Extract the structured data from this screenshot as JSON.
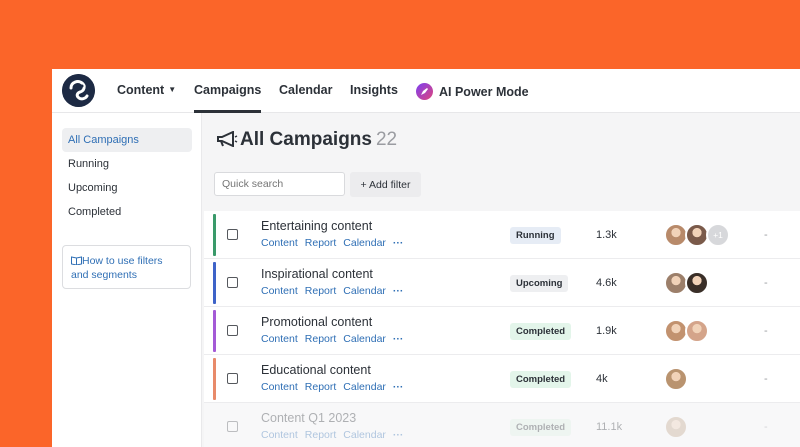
{
  "nav": {
    "items": [
      {
        "label": "Content",
        "has_caret": true
      },
      {
        "label": "Campaigns",
        "active": true
      },
      {
        "label": "Calendar"
      },
      {
        "label": "Insights"
      },
      {
        "label": "AI Power Mode"
      }
    ]
  },
  "sidebar": {
    "items": [
      {
        "label": "All Campaigns",
        "active": true
      },
      {
        "label": "Running"
      },
      {
        "label": "Upcoming"
      },
      {
        "label": "Completed"
      }
    ],
    "help_text": "How to use filters and segments"
  },
  "main": {
    "title": "All Campaigns",
    "count": "22",
    "search_placeholder": "Quick search",
    "add_filter_label": "+ Add filter",
    "row_links": [
      "Content",
      "Report",
      "Calendar",
      "···"
    ],
    "rows": [
      {
        "name": "Entertaining content",
        "status": "Running",
        "count": "1.3k",
        "avatar_extra": "+1",
        "dash": "-",
        "accent": "#3a9a6a"
      },
      {
        "name": "Inspirational content",
        "status": "Upcoming",
        "count": "4.6k",
        "dash": "-",
        "accent": "#3e63c8"
      },
      {
        "name": "Promotional content",
        "status": "Completed",
        "count": "1.9k",
        "dash": "-",
        "accent": "#a45ad6"
      },
      {
        "name": "Educational content",
        "status": "Completed",
        "count": "4k",
        "dash": "-",
        "accent": "#e88a6a"
      },
      {
        "name": "Content Q1 2023",
        "status": "Completed",
        "count": "11.1k",
        "dash": "-",
        "accent": "#ffffff"
      }
    ]
  },
  "colors": {
    "background": "#fb6529",
    "link": "#2f6fb5",
    "status_running_bg": "#e6ecf5",
    "status_upcoming_bg": "#eeeff1",
    "status_completed_bg": "#e3f5ea"
  }
}
